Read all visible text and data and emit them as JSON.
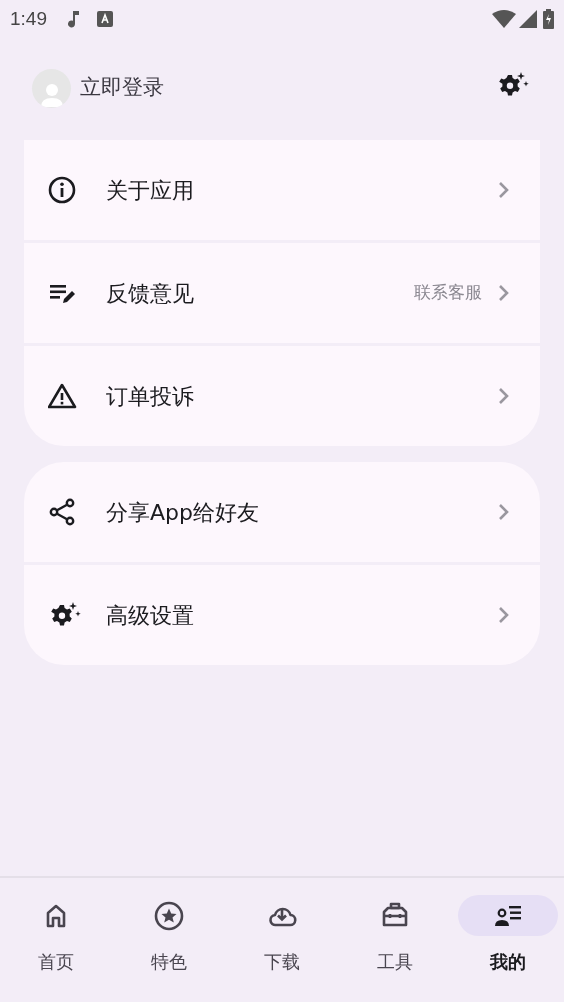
{
  "status_bar": {
    "time": "1:49"
  },
  "header": {
    "login_label": "立即登录"
  },
  "groups": [
    {
      "items": [
        {
          "label": "关于应用"
        },
        {
          "label": "反馈意见",
          "hint": "联系客服"
        },
        {
          "label": "订单投诉"
        }
      ]
    },
    {
      "items": [
        {
          "label": "分享App给好友"
        },
        {
          "label": "高级设置"
        }
      ]
    }
  ],
  "bottom_nav": [
    {
      "label": "首页",
      "selected": false
    },
    {
      "label": "特色",
      "selected": false
    },
    {
      "label": "下载",
      "selected": false
    },
    {
      "label": "工具",
      "selected": false
    },
    {
      "label": "我的",
      "selected": true
    }
  ]
}
